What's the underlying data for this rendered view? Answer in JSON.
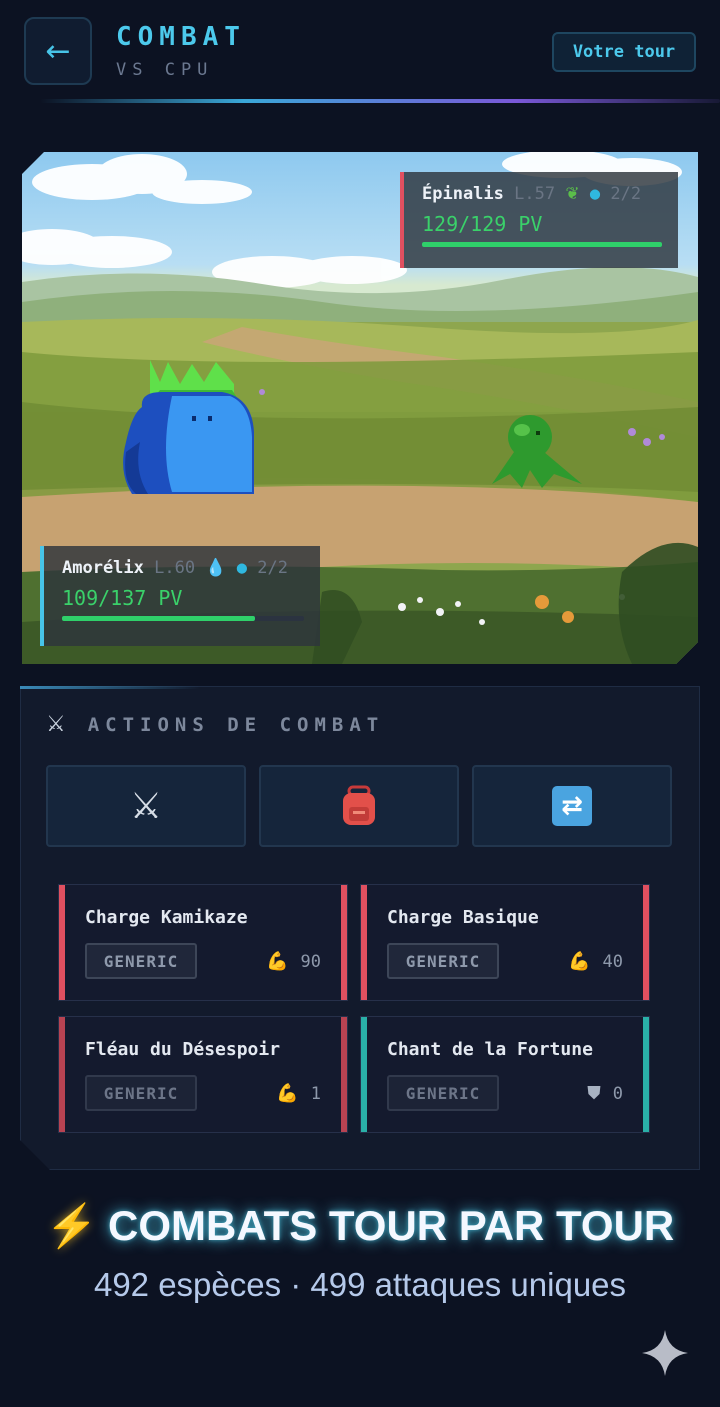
{
  "header": {
    "back_label": "←",
    "title": "COMBAT",
    "subtitle": "VS CPU",
    "turn_badge": "Votre tour"
  },
  "battle": {
    "enemy": {
      "name": "Épinalis",
      "level": "L.57",
      "type_icon": "leaf-icon",
      "team_count": "2/2",
      "hp_text": "129/129 PV",
      "hp_fraction": 1.0,
      "hp_color": "#2fd06a"
    },
    "player": {
      "name": "Amorélix",
      "level": "L.60",
      "type_icon": "water-drop-icon",
      "team_count": "2/2",
      "hp_text": "109/137 PV",
      "hp_fraction": 0.7956,
      "hp_color": "#2fd06a"
    }
  },
  "actions": {
    "title": "ACTIONS DE COMBAT",
    "header_icon": "crossed-swords-icon",
    "tabs": [
      {
        "name": "attack",
        "icon": "crossed-swords-icon",
        "glyph": "⚔"
      },
      {
        "name": "bag",
        "icon": "backpack-icon"
      },
      {
        "name": "switch",
        "icon": "switch-arrows-icon",
        "glyph": "⇄"
      }
    ],
    "moves": [
      {
        "name": "Charge Kamikaze",
        "type": "GENERIC",
        "stat_icon": "flexed-biceps-icon",
        "stat_value": "90",
        "accent": "#e05060"
      },
      {
        "name": "Charge Basique",
        "type": "GENERIC",
        "stat_icon": "flexed-biceps-icon",
        "stat_value": "40",
        "accent": "#e05060"
      },
      {
        "name": "Fléau du Désespoir",
        "type": "GENERIC",
        "stat_icon": "flexed-biceps-icon",
        "stat_value": "1",
        "accent": "#e05060"
      },
      {
        "name": "Chant de la Fortune",
        "type": "GENERIC",
        "stat_icon": "shield-icon",
        "stat_value": "0",
        "accent": "#2ab0a8"
      }
    ]
  },
  "promo": {
    "bolt": "⚡",
    "title": "COMBATS TOUR PAR TOUR",
    "subtitle": "492 espèces · 499 attaques uniques"
  },
  "colors": {
    "accent": "#4cc9ec",
    "background": "#0c1222",
    "hp_green": "#2fd06a",
    "physical_red": "#e05060",
    "status_teal": "#2ab0a8"
  }
}
